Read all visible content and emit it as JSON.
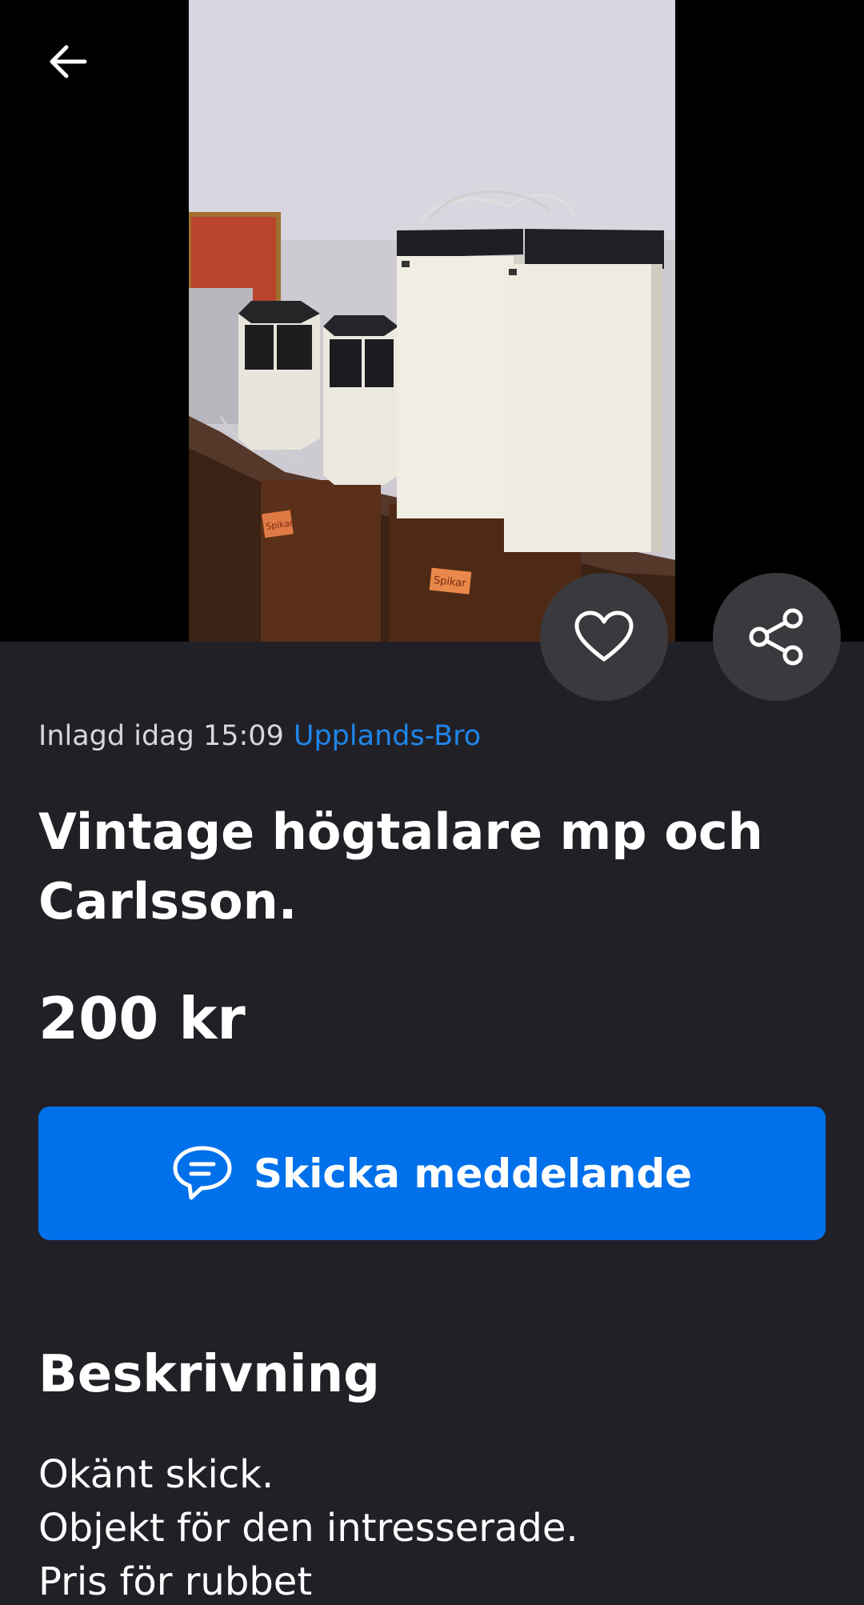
{
  "listing": {
    "posted": "Inlagd idag 15:09",
    "location": "Upplands-Bro",
    "title": "Vintage högtalare mp och Carlsson.",
    "price": "200 kr"
  },
  "actions": {
    "back_icon": "arrow-left-icon",
    "favorite_icon": "heart-icon",
    "share_icon": "share-icon",
    "message_icon": "chat-bubble-icon",
    "message_label": "Skicka meddelande"
  },
  "description": {
    "heading": "Beskrivning",
    "lines": [
      "Okänt skick.",
      "Objekt för den intresserade.",
      "Pris för rubbet"
    ]
  },
  "photo": {
    "labels": [
      "Spikar",
      "Spikar"
    ]
  },
  "colors": {
    "background": "#212026",
    "accent": "#0071ea",
    "link": "#1f86ea"
  }
}
